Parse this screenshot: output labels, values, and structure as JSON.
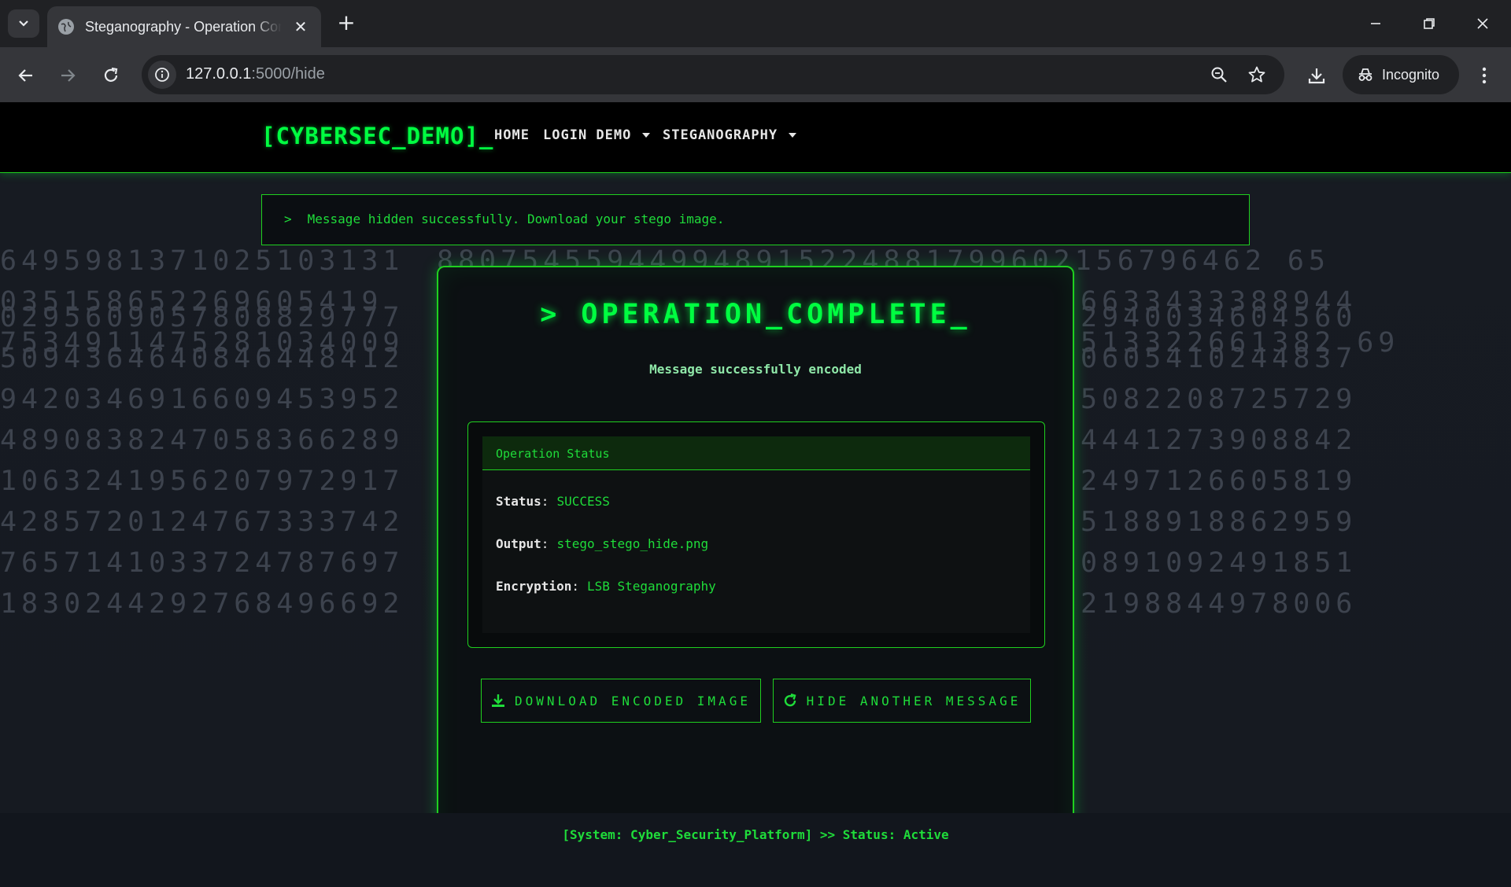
{
  "browser": {
    "tab_title": "Steganography - Operation Complete",
    "url_host": "127.0.0.1",
    "url_rest": ":5000/hide",
    "incognito_label": "Incognito"
  },
  "site_nav": {
    "brand": "[CYBERSEC_DEMO]_",
    "links": [
      "HOME",
      "LOGIN DEMO",
      "STEGANOGRAPHY"
    ]
  },
  "alert": {
    "prompt": ">",
    "message": "Message hidden successfully. Download your stego image."
  },
  "card": {
    "title": "> OPERATION_COMPLETE_",
    "subtitle": "Message successfully encoded",
    "status_header": "Operation Status",
    "rows": [
      {
        "key": "Status",
        "value": "SUCCESS"
      },
      {
        "key": "Output",
        "value": "stego_stego_hide.png"
      },
      {
        "key": "Encryption",
        "value": "LSB Steganography"
      }
    ],
    "download_button": "DOWNLOAD ENCODED IMAGE",
    "hide_another_button": "HIDE ANOTHER MESSAGE"
  },
  "matrix_left": [
    "6495981371025103131",
    "035158652269605419",
    "0295609057808829777",
    "7534911475281034009",
    "5094364640846448412",
    "9420346916609453952",
    "4890838247058366289",
    "1063241956207972917",
    "4285720124767333742",
    "7657141033724787697",
    "1830244292768496692"
  ],
  "matrix_right": [
    "880754559449948915224881799602156796462 65",
    "6633433388944",
    "2940034604560",
    "513322661382 69",
    "0605410244837",
    "5082208725729",
    "4441273908842",
    "2497126605819",
    "5188918862959",
    "0891092491851",
    "2198844978006"
  ],
  "footer": {
    "text": "[System: Cyber_Security_Platform] >> Status: Active"
  }
}
